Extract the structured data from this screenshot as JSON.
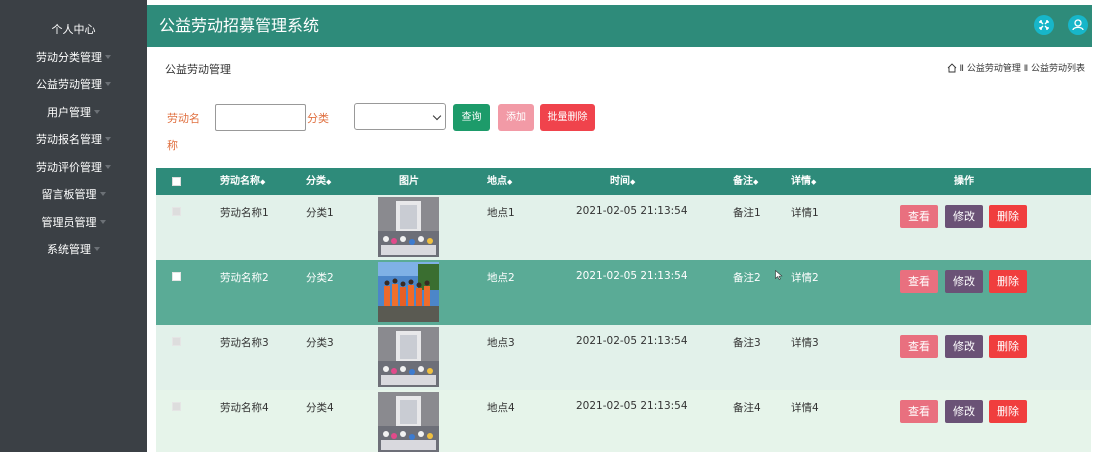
{
  "sidebar": {
    "items": [
      {
        "label": "个人中心",
        "caret": false
      },
      {
        "label": "劳动分类管理",
        "caret": true
      },
      {
        "label": "公益劳动管理",
        "caret": true
      },
      {
        "label": "用户管理",
        "caret": true
      },
      {
        "label": "劳动报名管理",
        "caret": true
      },
      {
        "label": "劳动评价管理",
        "caret": true
      },
      {
        "label": "留言板管理",
        "caret": true
      },
      {
        "label": "管理员管理",
        "caret": true
      },
      {
        "label": "系统管理",
        "caret": true
      }
    ]
  },
  "header": {
    "title": "公益劳动招募管理系统",
    "fullscreen_icon": "fullscreen-icon",
    "user_icon": "user-icon"
  },
  "page": {
    "title": "公益劳动管理",
    "breadcrumb": "Ⅱ 公益劳动管理 Ⅱ 公益劳动列表"
  },
  "search": {
    "name_label_1": "劳动名",
    "name_label_2": "称",
    "name_value": "",
    "category_label": "分类",
    "category_value": "",
    "query_btn": "查询",
    "add_btn": "添加",
    "batch_delete_btn": "批量删除"
  },
  "table": {
    "headers": {
      "name": "劳动名称",
      "category": "分类",
      "image": "图片",
      "place": "地点",
      "time": "时间",
      "note": "备注",
      "detail": "详情",
      "actions": "操作"
    },
    "sort_glyph": "◆",
    "rows": [
      {
        "name": "劳动名称1",
        "category": "分类1",
        "place": "地点1",
        "time": "2021-02-05 21:13:54",
        "note": "备注1",
        "detail": "详情1"
      },
      {
        "name": "劳动名称2",
        "category": "分类2",
        "place": "地点2",
        "time": "2021-02-05 21:13:54",
        "note": "备注2",
        "detail": "详情2"
      },
      {
        "name": "劳动名称3",
        "category": "分类3",
        "place": "地点3",
        "time": "2021-02-05 21:13:54",
        "note": "备注3",
        "detail": "详情3"
      },
      {
        "name": "劳动名称4",
        "category": "分类4",
        "place": "地点4",
        "time": "2021-02-05 21:13:54",
        "note": "备注4",
        "detail": "详情4"
      }
    ],
    "view_btn": "查看",
    "edit_btn": "修改",
    "delete_btn": "删除"
  },
  "colors": {
    "header_bg": "#2e8b7a",
    "sidebar_bg": "#3b4045",
    "highlight_row": "#5aab96"
  }
}
